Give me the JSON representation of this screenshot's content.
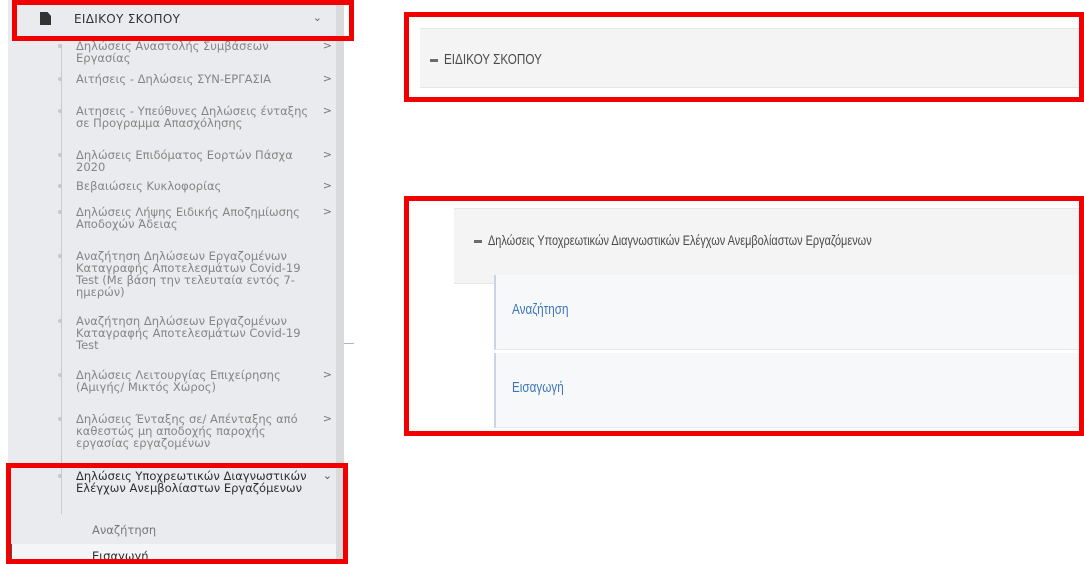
{
  "sidebar": {
    "section_label": "ΕΙΔΙΚΟΥ ΣΚΟΠΟΥ",
    "items": [
      {
        "label": "Δηλώσεις Αναστολής Συμβάσεων Εργασίας",
        "arrow": ">"
      },
      {
        "label": "Αιτήσεις - Δηλώσεις ΣΥΝ-ΕΡΓΑΣΙΑ",
        "arrow": ">"
      },
      {
        "label": "Αιτησεις - Υπεύθυνες Δηλώσεις ένταξης σε Προγραμμα Απασχόλησης",
        "arrow": ">"
      },
      {
        "label": "Δηλώσεις Επιδόματος Εορτών Πάσχα 2020",
        "arrow": ">"
      },
      {
        "label": "Βεβαιώσεις Κυκλοφορίας",
        "arrow": ">"
      },
      {
        "label": "Δηλώσεις Λήψης Ειδικής Αποζημίωσης Αποδοχών Άδειας",
        "arrow": ">"
      },
      {
        "label": "Αναζήτηση Δηλώσεων Εργαζομένων Καταγραφής Αποτελεσμάτων Covid-19 Test (Με βάση την τελευταία εντός 7-ημερών)",
        "arrow": ""
      },
      {
        "label": "Αναζήτηση Δηλώσεων Εργαζομένων Καταγραφής Αποτελεσμάτων Covid-19 Test",
        "arrow": ""
      },
      {
        "label": "Δηλώσεις Λειτουργίας Επιχείρησης (Αμιγής/ Μικτός Χώρος)",
        "arrow": ">"
      },
      {
        "label": "Δηλώσεις Ένταξης σε/ Απένταξης από καθεστώς μη αποδοχής παροχής εργασίας εργαζομένων",
        "arrow": ">"
      },
      {
        "label": "Δηλώσεις Υποχρεωτικών Διαγνωστικών Ελέγχων Ανεμβολίαστων Εργαζόμενων",
        "arrow": "⌄"
      }
    ],
    "subitems": [
      {
        "label": "Αναζήτηση"
      },
      {
        "label": "Εισαγωγή"
      }
    ]
  },
  "panel_top": {
    "label": "ΕΙΔΙΚΟΥ ΣΚΟΠΟΥ"
  },
  "panel_bottom": {
    "heading": "Δηλώσεις Υποχρεωτικών Διαγνωστικών Ελέγχων Ανεμβολίαστων Εργαζόμενων",
    "links": [
      {
        "label": "Αναζήτηση"
      },
      {
        "label": "Εισαγωγή"
      }
    ]
  },
  "colors": {
    "highlight": "#f20000",
    "link": "#3d77b7",
    "sidebar_bg": "#e9ebee"
  },
  "icons": [
    "document-icon",
    "chevron-down-icon",
    "chevron-right-icon",
    "minus-icon"
  ]
}
